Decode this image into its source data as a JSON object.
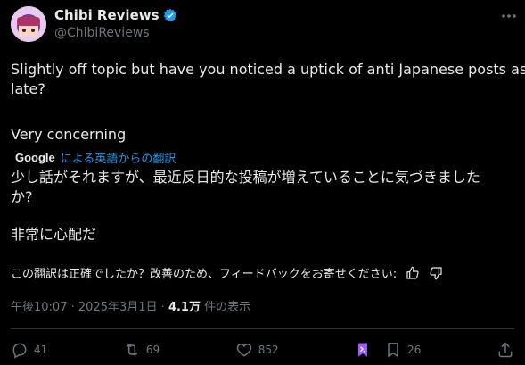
{
  "header": {
    "display_name": "Chibi Reviews",
    "handle": "@ChibiReviews"
  },
  "tweet": {
    "line1": "Slightly off topic but have you noticed a uptick of anti Japanese posts as of",
    "line2": "late?",
    "line3": "Very concerning"
  },
  "translation": {
    "brand": "Google",
    "by_label": "による英語からの翻訳",
    "line1": "少し話がそれますが、最近反日的な投稿が増えていることに気づきました",
    "line2": "か?",
    "line3": "非常に心配だ",
    "feedback": "この翻訳は正確でしたか？改善のため、フィードバックをお寄せください:"
  },
  "meta": {
    "time": "午後10:07",
    "date": "2025年3月1日",
    "views": "4.1万",
    "views_label": "件の表示"
  },
  "actions": {
    "replies": "41",
    "reposts": "69",
    "likes": "852",
    "bookmarks": "26"
  },
  "colors": {
    "accent": "#1d9bf0",
    "verified": "#1d9bf0",
    "muted": "#71767b",
    "text": "#e7e9ea",
    "background": "#000000"
  }
}
